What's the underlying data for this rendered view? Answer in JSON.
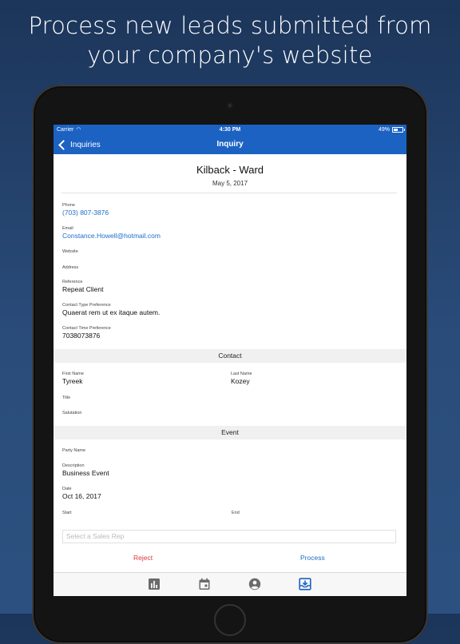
{
  "headline": {
    "line1": "Process new leads submitted from",
    "line2": "your company's website"
  },
  "status_bar": {
    "carrier": "Carrier",
    "time": "4:30 PM",
    "battery": "49%"
  },
  "nav": {
    "back_label": "Inquiries",
    "title": "Inquiry"
  },
  "inquiry": {
    "name": "Kilback - Ward",
    "date": "May 5, 2017"
  },
  "details": {
    "phone_label": "Phone",
    "phone": "(703) 807-3876",
    "email_label": "Email",
    "email": "Constance.Howell@hotmail.com",
    "website_label": "Website",
    "address_label": "Address",
    "reference_label": "Reference",
    "reference": "Repeat Client",
    "contact_type_label": "Contact Type Preference",
    "contact_type": "Quaerat rem ut ex itaque autem.",
    "contact_time_label": "Contact Time Preference",
    "contact_time": "7038073876"
  },
  "contact": {
    "section_title": "Contact",
    "first_name_label": "First Name",
    "first_name": "Tyreek",
    "last_name_label": "Last Name",
    "last_name": "Kozey",
    "title_label": "Title",
    "salutation_label": "Salutation"
  },
  "event": {
    "section_title": "Event",
    "party_name_label": "Party Name",
    "description_label": "Description",
    "description": "Business Event",
    "date_label": "Date",
    "date": "Oct 16, 2017",
    "start_label": "Start",
    "end_label": "End"
  },
  "sales_rep": {
    "placeholder": "Select a Sales Rep"
  },
  "actions": {
    "reject": "Reject",
    "process": "Process"
  },
  "tabs": [
    {
      "icon": "bar-chart-icon",
      "selected": false
    },
    {
      "icon": "calendar-icon",
      "selected": false
    },
    {
      "icon": "account-icon",
      "selected": false
    },
    {
      "icon": "inbox-download-icon",
      "selected": true
    }
  ],
  "colors": {
    "accent": "#1b62c3",
    "link": "#1f6ec8",
    "reject": "#d93838",
    "background": "#1f3b63"
  }
}
